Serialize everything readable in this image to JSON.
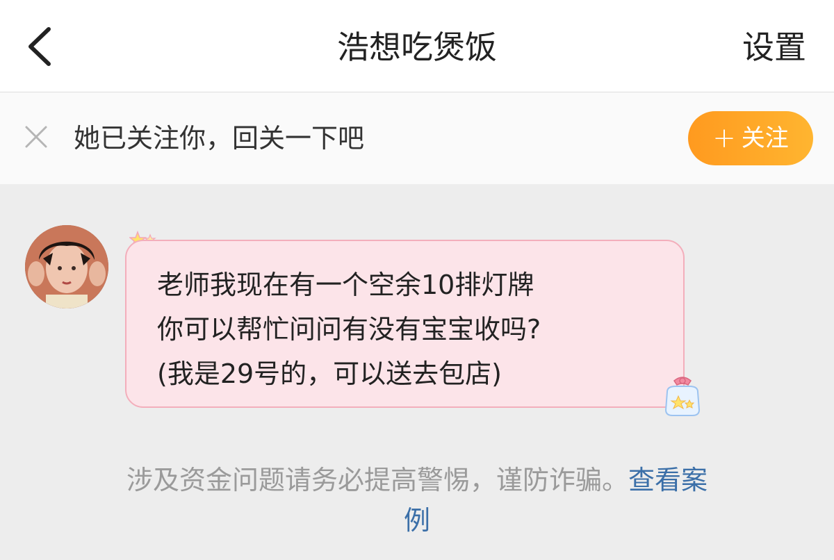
{
  "header": {
    "title": "浩想吃煲饭",
    "settings_label": "设置"
  },
  "follow_bar": {
    "message": "她已关注你，回关一下吧",
    "button_plus": "+",
    "button_label": "关注"
  },
  "message": {
    "lines": [
      "老师我现在有一个空余10排灯牌",
      "你可以帮忙问问有没有宝宝收吗?",
      "(我是29号的，可以送去包店)"
    ]
  },
  "warning": {
    "text": "涉及资金问题请务必提高警惕，谨防诈骗。",
    "link_part1": "查看案",
    "link_part2": "例"
  },
  "icons": {
    "back": "chevron-left-icon",
    "close": "close-icon",
    "star_decoration": "star-icon",
    "bottle_decoration": "star-bottle-icon"
  },
  "colors": {
    "follow_button": "#ffa726",
    "bubble_fill": "#fce4e9",
    "bubble_border": "#f3aebb",
    "link": "#3b6fa8"
  }
}
